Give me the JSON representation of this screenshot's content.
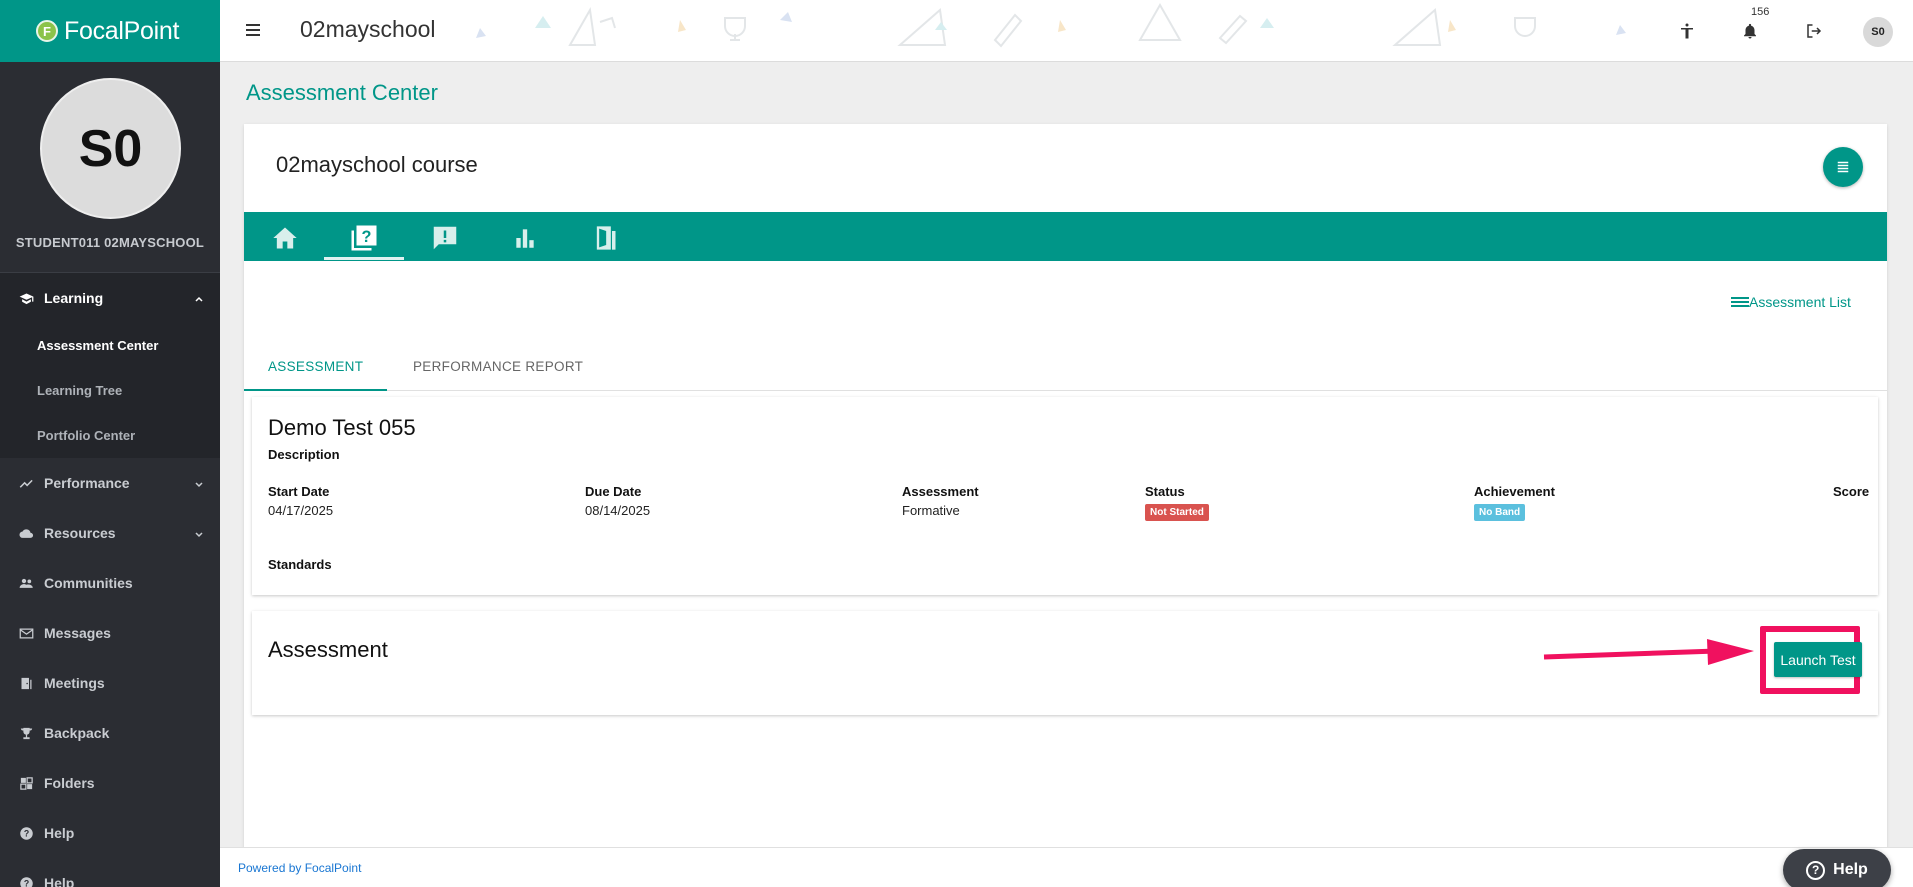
{
  "app": {
    "brand_mark": "F",
    "brand_name": "FocalPoint",
    "school_name": "02mayschool",
    "notification_count": "156",
    "user_initials": "S0",
    "top_icons": [
      "accessibility-icon",
      "bell-icon",
      "logout-icon"
    ]
  },
  "sidebar": {
    "avatar_initials": "S0",
    "user_name": "STUDENT011 02MAYSCHOOL",
    "items": [
      {
        "label": "Learning",
        "icon": "graduation-cap-icon",
        "expanded": true,
        "children": [
          {
            "label": "Assessment Center"
          },
          {
            "label": "Learning Tree"
          },
          {
            "label": "Portfolio Center"
          }
        ]
      },
      {
        "label": "Performance",
        "icon": "trend-icon"
      },
      {
        "label": "Resources",
        "icon": "cloud-icon"
      },
      {
        "label": "Communities",
        "icon": "people-icon"
      },
      {
        "label": "Messages",
        "icon": "mail-icon"
      },
      {
        "label": "Meetings",
        "icon": "door-icon"
      },
      {
        "label": "Backpack",
        "icon": "trophy-icon"
      },
      {
        "label": "Folders",
        "icon": "folders-icon"
      },
      {
        "label": "Help",
        "icon": "help-icon"
      },
      {
        "label": "Help",
        "icon": "help-icon"
      }
    ]
  },
  "main": {
    "page_title": "Assessment Center",
    "course_title": "02mayschool course",
    "course_tabs": [
      "home-icon",
      "quiz-icon",
      "announcement-icon",
      "bar-chart-icon",
      "exit-door-icon"
    ],
    "assessment_list_link": "Assessment List",
    "subtabs": [
      {
        "label": "ASSESSMENT",
        "active": true
      },
      {
        "label": "PERFORMANCE REPORT",
        "active": false
      }
    ],
    "test": {
      "title": "Demo Test 055",
      "description_label": "Description",
      "start_date_label": "Start Date",
      "start_date": "04/17/2025",
      "due_date_label": "Due Date",
      "due_date": "08/14/2025",
      "assessment_label": "Assessment",
      "assessment_type": "Formative",
      "status_label": "Status",
      "status": "Not Started",
      "achievement_label": "Achievement",
      "achievement": "No Band",
      "score_label": "Score",
      "standards_label": "Standards"
    },
    "assessment_panel": {
      "title": "Assessment",
      "launch_label": "Launch Test"
    }
  },
  "footer": {
    "powered_by": "Powered by FocalPoint",
    "help_button": "Help"
  },
  "colors": {
    "primary": "#009688",
    "sidebar_bg": "#2b2d33",
    "status_not_started": "#d9534f",
    "badge_no_band": "#5bc0de",
    "annotation": "#f0115f"
  }
}
